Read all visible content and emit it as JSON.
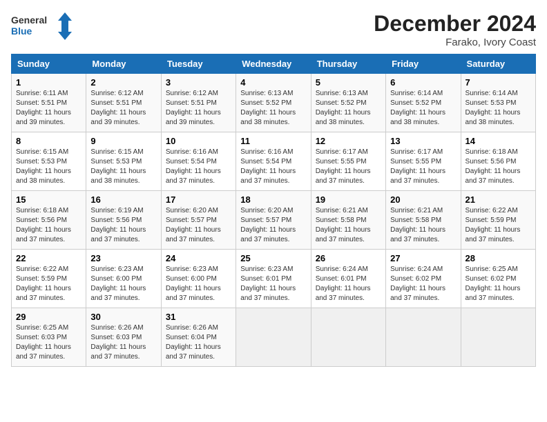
{
  "logo": {
    "line1": "General",
    "line2": "Blue"
  },
  "title": "December 2024",
  "location": "Farako, Ivory Coast",
  "days_of_week": [
    "Sunday",
    "Monday",
    "Tuesday",
    "Wednesday",
    "Thursday",
    "Friday",
    "Saturday"
  ],
  "weeks": [
    [
      {
        "day": "1",
        "info": "Sunrise: 6:11 AM\nSunset: 5:51 PM\nDaylight: 11 hours\nand 39 minutes."
      },
      {
        "day": "2",
        "info": "Sunrise: 6:12 AM\nSunset: 5:51 PM\nDaylight: 11 hours\nand 39 minutes."
      },
      {
        "day": "3",
        "info": "Sunrise: 6:12 AM\nSunset: 5:51 PM\nDaylight: 11 hours\nand 39 minutes."
      },
      {
        "day": "4",
        "info": "Sunrise: 6:13 AM\nSunset: 5:52 PM\nDaylight: 11 hours\nand 38 minutes."
      },
      {
        "day": "5",
        "info": "Sunrise: 6:13 AM\nSunset: 5:52 PM\nDaylight: 11 hours\nand 38 minutes."
      },
      {
        "day": "6",
        "info": "Sunrise: 6:14 AM\nSunset: 5:52 PM\nDaylight: 11 hours\nand 38 minutes."
      },
      {
        "day": "7",
        "info": "Sunrise: 6:14 AM\nSunset: 5:53 PM\nDaylight: 11 hours\nand 38 minutes."
      }
    ],
    [
      {
        "day": "8",
        "info": "Sunrise: 6:15 AM\nSunset: 5:53 PM\nDaylight: 11 hours\nand 38 minutes."
      },
      {
        "day": "9",
        "info": "Sunrise: 6:15 AM\nSunset: 5:53 PM\nDaylight: 11 hours\nand 38 minutes."
      },
      {
        "day": "10",
        "info": "Sunrise: 6:16 AM\nSunset: 5:54 PM\nDaylight: 11 hours\nand 37 minutes."
      },
      {
        "day": "11",
        "info": "Sunrise: 6:16 AM\nSunset: 5:54 PM\nDaylight: 11 hours\nand 37 minutes."
      },
      {
        "day": "12",
        "info": "Sunrise: 6:17 AM\nSunset: 5:55 PM\nDaylight: 11 hours\nand 37 minutes."
      },
      {
        "day": "13",
        "info": "Sunrise: 6:17 AM\nSunset: 5:55 PM\nDaylight: 11 hours\nand 37 minutes."
      },
      {
        "day": "14",
        "info": "Sunrise: 6:18 AM\nSunset: 5:56 PM\nDaylight: 11 hours\nand 37 minutes."
      }
    ],
    [
      {
        "day": "15",
        "info": "Sunrise: 6:18 AM\nSunset: 5:56 PM\nDaylight: 11 hours\nand 37 minutes."
      },
      {
        "day": "16",
        "info": "Sunrise: 6:19 AM\nSunset: 5:56 PM\nDaylight: 11 hours\nand 37 minutes."
      },
      {
        "day": "17",
        "info": "Sunrise: 6:20 AM\nSunset: 5:57 PM\nDaylight: 11 hours\nand 37 minutes."
      },
      {
        "day": "18",
        "info": "Sunrise: 6:20 AM\nSunset: 5:57 PM\nDaylight: 11 hours\nand 37 minutes."
      },
      {
        "day": "19",
        "info": "Sunrise: 6:21 AM\nSunset: 5:58 PM\nDaylight: 11 hours\nand 37 minutes."
      },
      {
        "day": "20",
        "info": "Sunrise: 6:21 AM\nSunset: 5:58 PM\nDaylight: 11 hours\nand 37 minutes."
      },
      {
        "day": "21",
        "info": "Sunrise: 6:22 AM\nSunset: 5:59 PM\nDaylight: 11 hours\nand 37 minutes."
      }
    ],
    [
      {
        "day": "22",
        "info": "Sunrise: 6:22 AM\nSunset: 5:59 PM\nDaylight: 11 hours\nand 37 minutes."
      },
      {
        "day": "23",
        "info": "Sunrise: 6:23 AM\nSunset: 6:00 PM\nDaylight: 11 hours\nand 37 minutes."
      },
      {
        "day": "24",
        "info": "Sunrise: 6:23 AM\nSunset: 6:00 PM\nDaylight: 11 hours\nand 37 minutes."
      },
      {
        "day": "25",
        "info": "Sunrise: 6:23 AM\nSunset: 6:01 PM\nDaylight: 11 hours\nand 37 minutes."
      },
      {
        "day": "26",
        "info": "Sunrise: 6:24 AM\nSunset: 6:01 PM\nDaylight: 11 hours\nand 37 minutes."
      },
      {
        "day": "27",
        "info": "Sunrise: 6:24 AM\nSunset: 6:02 PM\nDaylight: 11 hours\nand 37 minutes."
      },
      {
        "day": "28",
        "info": "Sunrise: 6:25 AM\nSunset: 6:02 PM\nDaylight: 11 hours\nand 37 minutes."
      }
    ],
    [
      {
        "day": "29",
        "info": "Sunrise: 6:25 AM\nSunset: 6:03 PM\nDaylight: 11 hours\nand 37 minutes."
      },
      {
        "day": "30",
        "info": "Sunrise: 6:26 AM\nSunset: 6:03 PM\nDaylight: 11 hours\nand 37 minutes."
      },
      {
        "day": "31",
        "info": "Sunrise: 6:26 AM\nSunset: 6:04 PM\nDaylight: 11 hours\nand 37 minutes."
      },
      null,
      null,
      null,
      null
    ]
  ]
}
